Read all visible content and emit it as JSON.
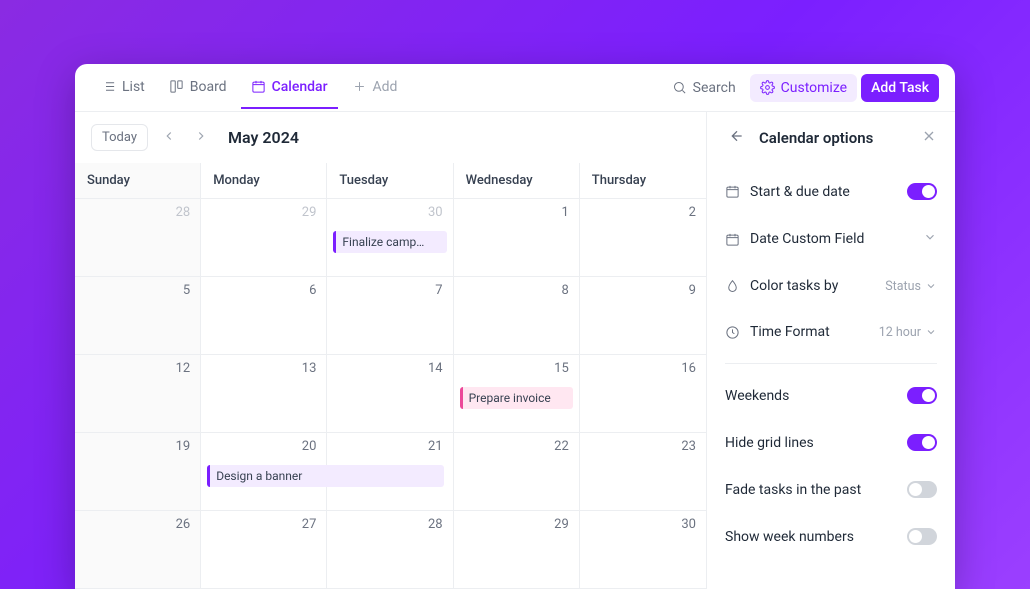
{
  "toolbar": {
    "views": {
      "list": "List",
      "board": "Board",
      "calendar": "Calendar",
      "add": "Add"
    },
    "search": "Search",
    "customize": "Customize",
    "add_task": "Add Task"
  },
  "datebar": {
    "today": "Today",
    "month": "May 2024"
  },
  "weekdays": [
    "Sunday",
    "Monday",
    "Tuesday",
    "Wednesday",
    "Thursday"
  ],
  "days": [
    {
      "n": "28",
      "dim": true
    },
    {
      "n": "29",
      "dim": true
    },
    {
      "n": "30",
      "dim": true
    },
    {
      "n": "1"
    },
    {
      "n": "2"
    },
    {
      "n": "5"
    },
    {
      "n": "6"
    },
    {
      "n": "7"
    },
    {
      "n": "8"
    },
    {
      "n": "9"
    },
    {
      "n": "12"
    },
    {
      "n": "13"
    },
    {
      "n": "14"
    },
    {
      "n": "15"
    },
    {
      "n": "16"
    },
    {
      "n": "19"
    },
    {
      "n": "20"
    },
    {
      "n": "21"
    },
    {
      "n": "22"
    },
    {
      "n": "23"
    },
    {
      "n": "26"
    },
    {
      "n": "27"
    },
    {
      "n": "28"
    },
    {
      "n": "29"
    },
    {
      "n": "30"
    }
  ],
  "tasks": {
    "finalize": "Finalize camp…",
    "invoice": "Prepare invoice",
    "banner": "Design a banner"
  },
  "sidebar": {
    "title": "Calendar options",
    "start_due": "Start & due date",
    "date_custom": "Date Custom Field",
    "color_by": "Color tasks by",
    "color_by_val": "Status",
    "time_format": "Time Format",
    "time_format_val": "12 hour",
    "weekends": "Weekends",
    "hide_grid": "Hide grid lines",
    "fade_past": "Fade tasks in the past",
    "week_numbers": "Show week numbers"
  }
}
